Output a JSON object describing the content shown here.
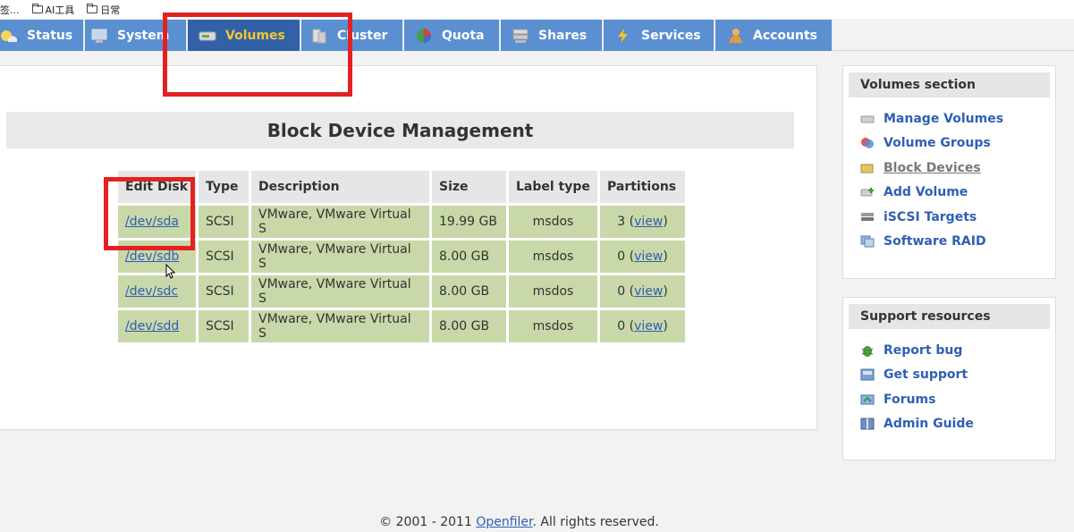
{
  "bookmarks": [
    {
      "label": "签..."
    },
    {
      "label": "AI工具"
    },
    {
      "label": "日常"
    }
  ],
  "tabs": [
    {
      "label": "Status",
      "icon": "status-icon",
      "active": false
    },
    {
      "label": "System",
      "icon": "system-icon",
      "active": false
    },
    {
      "label": "Volumes",
      "icon": "volumes-icon",
      "active": true
    },
    {
      "label": "Cluster",
      "icon": "cluster-icon",
      "active": false
    },
    {
      "label": "Quota",
      "icon": "quota-icon",
      "active": false
    },
    {
      "label": "Shares",
      "icon": "shares-icon",
      "active": false
    },
    {
      "label": "Services",
      "icon": "services-icon",
      "active": false
    },
    {
      "label": "Accounts",
      "icon": "accounts-icon",
      "active": false
    }
  ],
  "main": {
    "title": "Block Device Management",
    "table": {
      "headers": [
        "Edit Disk",
        "Type",
        "Description",
        "Size",
        "Label type",
        "Partitions"
      ],
      "rows": [
        {
          "disk": "/dev/sda",
          "type": "SCSI",
          "description": "VMware, VMware Virtual S",
          "size": "19.99 GB",
          "label_type": "msdos",
          "partitions_count": "3",
          "view": "view"
        },
        {
          "disk": "/dev/sdb",
          "type": "SCSI",
          "description": "VMware, VMware Virtual S",
          "size": "8.00 GB",
          "label_type": "msdos",
          "partitions_count": "0",
          "view": "view"
        },
        {
          "disk": "/dev/sdc",
          "type": "SCSI",
          "description": "VMware, VMware Virtual S",
          "size": "8.00 GB",
          "label_type": "msdos",
          "partitions_count": "0",
          "view": "view"
        },
        {
          "disk": "/dev/sdd",
          "type": "SCSI",
          "description": "VMware, VMware Virtual S",
          "size": "8.00 GB",
          "label_type": "msdos",
          "partitions_count": "0",
          "view": "view"
        }
      ]
    }
  },
  "volumes_section": {
    "title": "Volumes section",
    "items": [
      {
        "label": "Manage Volumes",
        "icon": "manage-volumes-icon"
      },
      {
        "label": "Volume Groups",
        "icon": "volume-groups-icon"
      },
      {
        "label": "Block Devices",
        "icon": "block-devices-icon",
        "current": true
      },
      {
        "label": "Add Volume",
        "icon": "add-volume-icon"
      },
      {
        "label": "iSCSI Targets",
        "icon": "iscsi-targets-icon"
      },
      {
        "label": "Software RAID",
        "icon": "software-raid-icon"
      }
    ]
  },
  "support": {
    "title": "Support resources",
    "items": [
      {
        "label": "Report bug",
        "icon": "bug-icon"
      },
      {
        "label": "Get support",
        "icon": "support-icon"
      },
      {
        "label": "Forums",
        "icon": "forums-icon"
      },
      {
        "label": "Admin Guide",
        "icon": "admin-guide-icon"
      }
    ]
  },
  "footer": {
    "prefix": "© 2001 - 2011 ",
    "link": "Openfiler",
    "suffix": ". All rights reserved."
  },
  "colors": {
    "tab": "#5a8fd1",
    "tab_active": "#3261a8",
    "tab_active_text": "#f3c631",
    "row": "#c9d8a8",
    "link": "#2f5fb3",
    "highlight": "#e42121"
  }
}
